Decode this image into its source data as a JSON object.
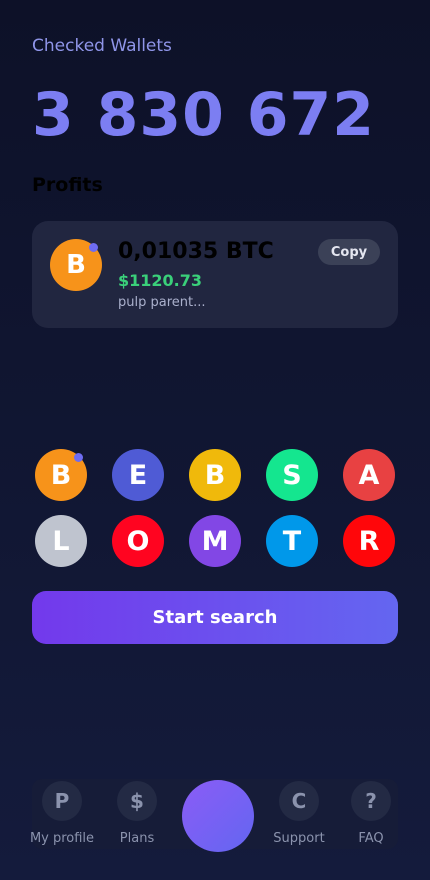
{
  "stats": {
    "checked_label": "Checked Wallets",
    "checked_value": "3 830 672"
  },
  "profits": {
    "title": "Profits",
    "item": {
      "coin_letter": "B",
      "amount": "0,01035 BTC",
      "usd": "$1120.73",
      "phrase": "pulp parent...",
      "copy_label": "Copy"
    }
  },
  "coins": [
    {
      "letter": "B",
      "color": "#f7931a",
      "icon": "bitcoin-icon",
      "dot": true
    },
    {
      "letter": "E",
      "color": "#4f5bd5",
      "icon": "ethereum-icon",
      "dot": false
    },
    {
      "letter": "B",
      "color": "#f0b90b",
      "icon": "binance-icon",
      "dot": false
    },
    {
      "letter": "S",
      "color": "#14e68f",
      "icon": "solana-icon",
      "dot": false
    },
    {
      "letter": "A",
      "color": "#e84142",
      "icon": "avalanche-icon",
      "dot": false
    },
    {
      "letter": "L",
      "color": "#bfc4cf",
      "icon": "litecoin-icon",
      "dot": false
    },
    {
      "letter": "O",
      "color": "#ff0420",
      "icon": "optimism-icon",
      "dot": false
    },
    {
      "letter": "M",
      "color": "#8247e5",
      "icon": "polygon-icon",
      "dot": false
    },
    {
      "letter": "T",
      "color": "#0098ea",
      "icon": "toncoin-icon",
      "dot": false
    },
    {
      "letter": "R",
      "color": "#ff060a",
      "icon": "tron-icon",
      "dot": false
    }
  ],
  "actions": {
    "start_label": "Start search"
  },
  "nav": {
    "profile": {
      "icon_letter": "P",
      "label": "My profile"
    },
    "plans": {
      "icon_letter": "$",
      "label": "Plans"
    },
    "support": {
      "icon_letter": "C",
      "label": "Support"
    },
    "faq": {
      "icon_letter": "?",
      "label": "FAQ"
    }
  }
}
